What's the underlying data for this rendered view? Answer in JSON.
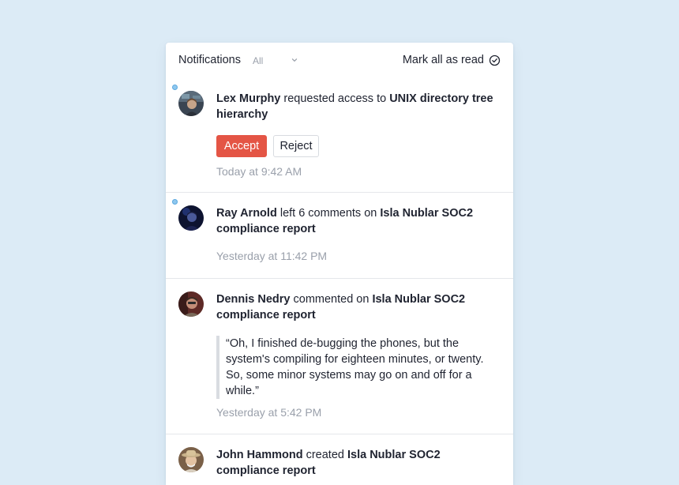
{
  "header": {
    "title": "Notifications",
    "filter_value": "All",
    "mark_all_label": "Mark all as read",
    "mark_all_icon": "check-circle-icon",
    "filter_icon": "chevron-down-icon"
  },
  "colors": {
    "background": "#dcebf6",
    "accept": "#e45545",
    "unread": "#8fc7ee",
    "muted": "#9aa0ab"
  },
  "notifications": [
    {
      "unread": true,
      "actor": "Lex Murphy",
      "action": " requested access to ",
      "target": "UNIX directory tree hierarchy",
      "accept_label": "Accept",
      "reject_label": "Reject",
      "time": "Today at 9:42 AM"
    },
    {
      "unread": true,
      "actor": "Ray Arnold",
      "action": " left 6 comments on ",
      "target": "Isla Nublar SOC2 compliance report",
      "time": "Yesterday at 11:42 PM"
    },
    {
      "unread": false,
      "actor": "Dennis Nedry",
      "action": " commented on ",
      "target": "Isla Nublar SOC2 compliance report",
      "quote": "“Oh, I finished de-bugging the phones, but the system's compiling for eighteen minutes, or twenty. So, some minor systems may go on and off for a while.”",
      "time": "Yesterday at 5:42 PM"
    },
    {
      "unread": false,
      "actor": "John Hammond",
      "action": " created ",
      "target": "Isla Nublar SOC2 compliance report"
    }
  ]
}
